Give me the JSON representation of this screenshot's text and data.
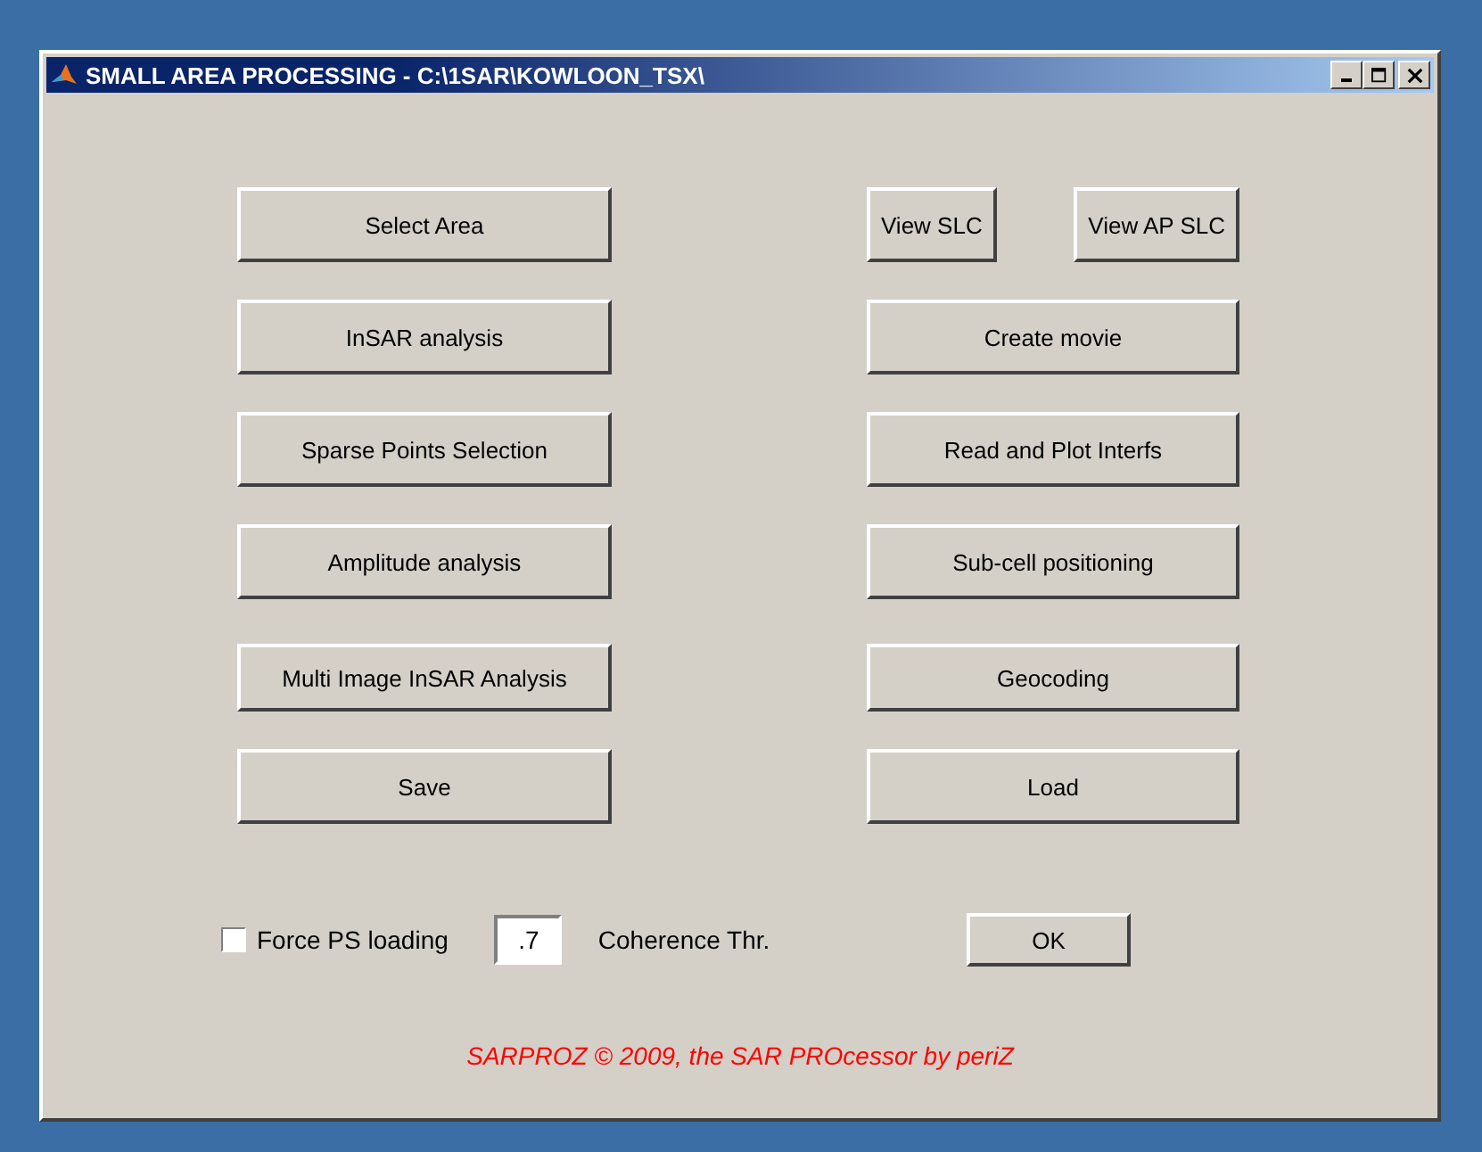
{
  "window": {
    "title": "SMALL AREA PROCESSING - C:\\1SAR\\KOWLOON_TSX\\"
  },
  "rows": [
    {
      "left": "Select Area",
      "right": [
        "View SLC",
        "View AP SLC"
      ]
    },
    {
      "left": "InSAR analysis",
      "right": [
        "Create movie"
      ]
    },
    {
      "left": "Sparse Points Selection",
      "right": [
        "Read and Plot Interfs"
      ]
    },
    {
      "left": "Amplitude analysis",
      "right": [
        "Sub-cell positioning"
      ]
    },
    {
      "left": "Multi Image InSAR Analysis",
      "right": [
        "Geocoding"
      ]
    },
    {
      "left": "Save",
      "right": [
        "Load"
      ]
    }
  ],
  "force_ps": {
    "label": "Force PS loading",
    "checked": false
  },
  "coherence": {
    "value": ".7",
    "label": "Coherence Thr."
  },
  "ok_button": "OK",
  "footer": "SARPROZ © 2009, the SAR PROcessor by periZ"
}
